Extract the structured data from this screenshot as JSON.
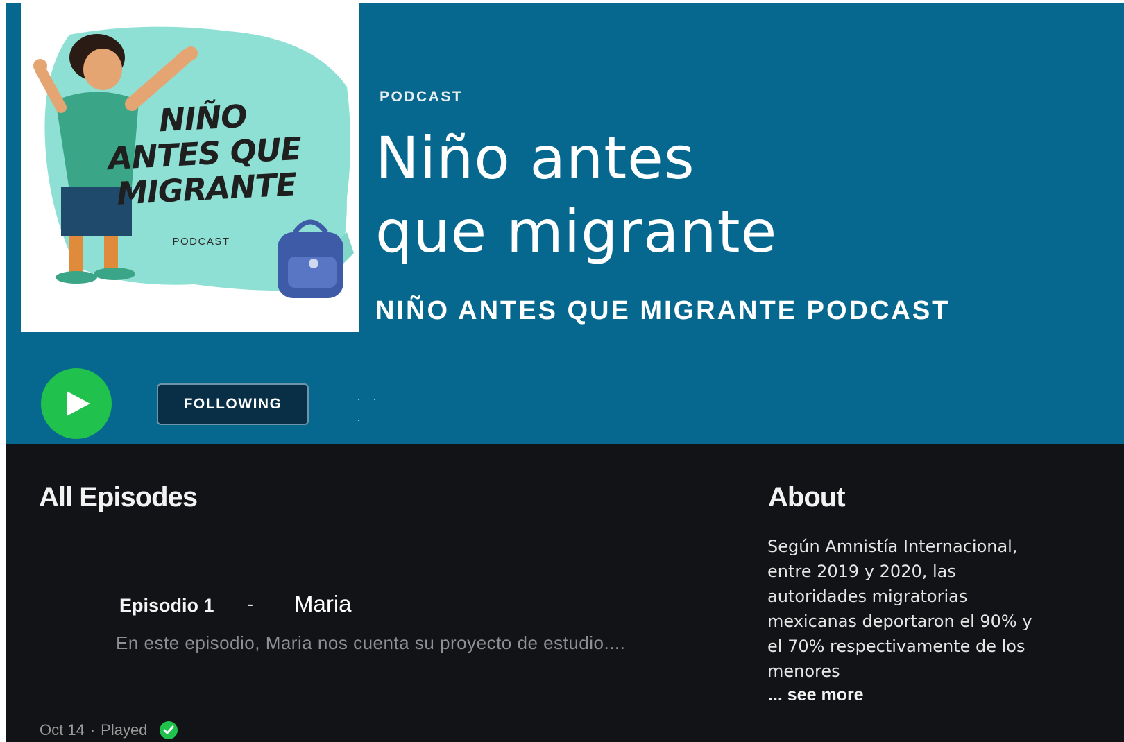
{
  "header": {
    "cover": {
      "title": "NIÑO ANTES QUE MIGRANTE",
      "subtitle": "PODCAST"
    },
    "type_label": "PODCAST",
    "title_line1": "Niño antes",
    "title_line2": "que migrante",
    "publisher": "NIÑO ANTES QUE MIGRANTE PODCAST",
    "background_color": "#06688e"
  },
  "actions": {
    "play_icon": "play-icon",
    "follow_label": "FOLLOWING",
    "more_label": "· · ·",
    "accent_color": "#21c14e"
  },
  "episodes": {
    "heading": "All Episodes",
    "items": [
      {
        "number": "Episodio 1",
        "separator": "-",
        "name": "Maria",
        "description": "En este episodio,  Maria nos cuenta su proyecto de estudio....",
        "date": "Oct 14",
        "status": "Played",
        "status_icon": "check-circle-icon"
      }
    ]
  },
  "about": {
    "heading": "About",
    "text": "Según Amnistía Internacional, entre 2019 y 2020, las autoridades migratorias mexicanas deportaron el 90% y el 70% respectivamente de los menores",
    "see_more": "... see more"
  }
}
